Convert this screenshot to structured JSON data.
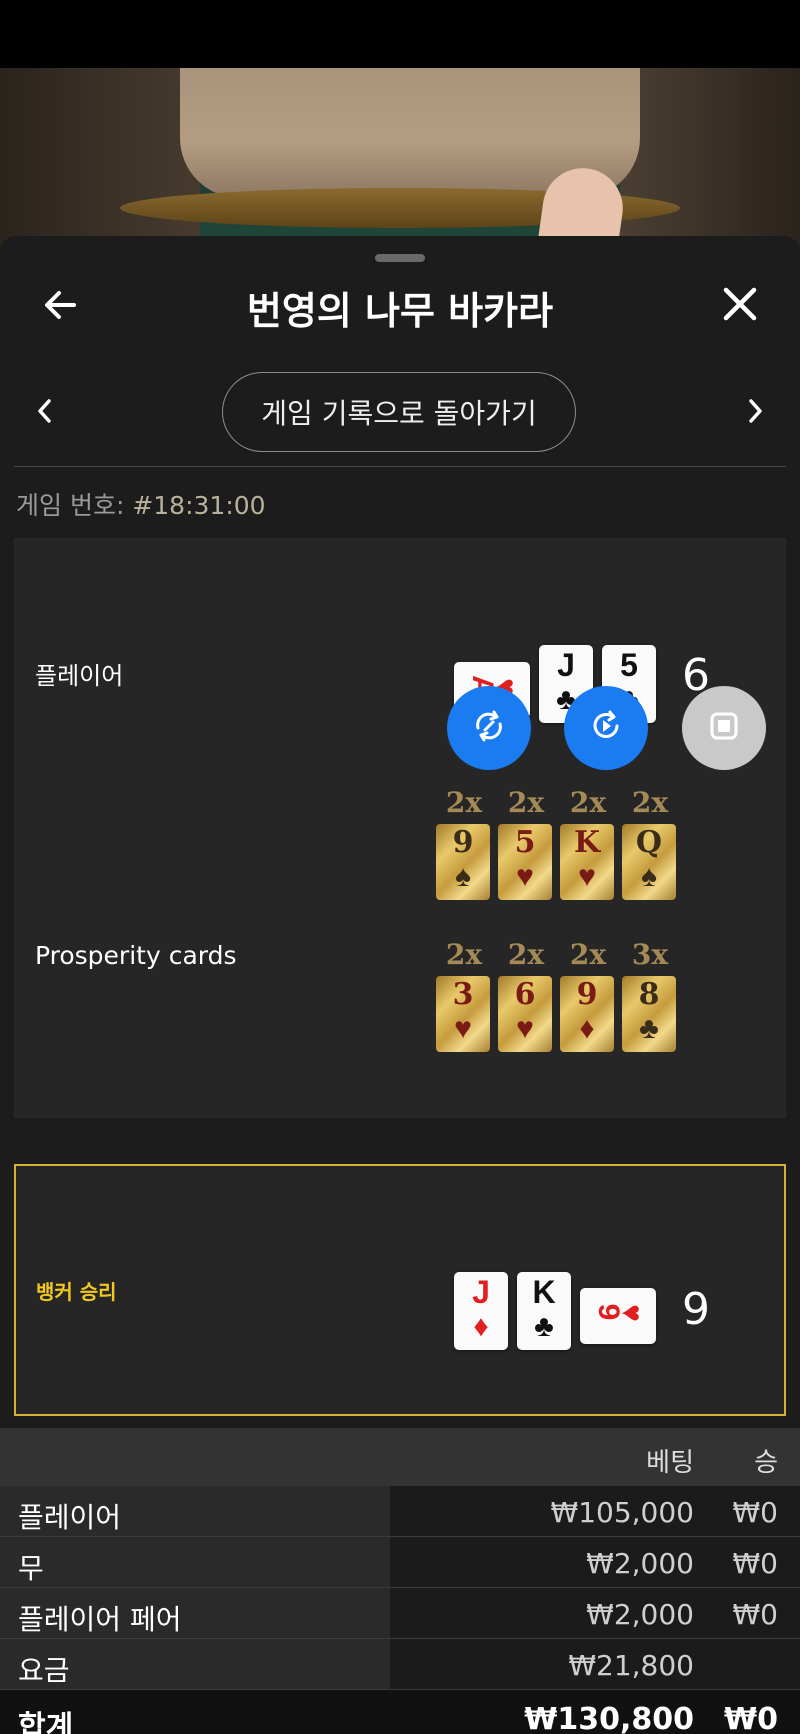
{
  "header": {
    "title": "번영의 나무 바카라"
  },
  "nav": {
    "back_to_history": "게임 기록으로 돌아가기"
  },
  "game": {
    "number_label": "게임 번호:",
    "number_value": "#18:31:00"
  },
  "player": {
    "label": "플레이어",
    "score": "6",
    "cards": [
      {
        "rank": "A",
        "suit": "♥",
        "color": "red"
      },
      {
        "rank": "J",
        "suit": "♣",
        "color": "black"
      },
      {
        "rank": "5",
        "suit": "♣",
        "color": "black"
      }
    ]
  },
  "prosperity": {
    "label": "Prosperity cards",
    "row1": [
      {
        "mult": "2x",
        "rank": "9",
        "suit": "♠",
        "color": "dark"
      },
      {
        "mult": "2x",
        "rank": "5",
        "suit": "♥",
        "color": "red"
      },
      {
        "mult": "2x",
        "rank": "K",
        "suit": "♥",
        "color": "red"
      },
      {
        "mult": "2x",
        "rank": "Q",
        "suit": "♠",
        "color": "dark"
      }
    ],
    "row2": [
      {
        "mult": "2x",
        "rank": "3",
        "suit": "♥",
        "color": "red"
      },
      {
        "mult": "2x",
        "rank": "6",
        "suit": "♥",
        "color": "red"
      },
      {
        "mult": "2x",
        "rank": "9",
        "suit": "♦",
        "color": "red"
      },
      {
        "mult": "3x",
        "rank": "8",
        "suit": "♣",
        "color": "dark"
      }
    ]
  },
  "banker": {
    "label": "뱅커 승리",
    "score": "9",
    "cards": [
      {
        "rank": "J",
        "suit": "♦",
        "color": "red"
      },
      {
        "rank": "K",
        "suit": "♣",
        "color": "black"
      },
      {
        "rank": "9",
        "suit": "♥",
        "color": "red"
      }
    ]
  },
  "bets_table": {
    "headers": {
      "bet": "베팅",
      "win": "승"
    },
    "rows": [
      {
        "label": "플레이어",
        "bet": "₩105,000",
        "win": "₩0"
      },
      {
        "label": "무",
        "bet": "₩2,000",
        "win": "₩0"
      },
      {
        "label": "플레이어 페어",
        "bet": "₩2,000",
        "win": "₩0"
      },
      {
        "label": "요금",
        "bet": "₩21,800",
        "win": ""
      }
    ],
    "total": {
      "label": "합계",
      "bet": "₩130,800",
      "win": "₩0"
    }
  },
  "icons": {
    "back": "arrow-left-icon",
    "close": "close-icon",
    "prev": "chevron-left-icon",
    "next": "chevron-right-icon",
    "replay": "replay-icon",
    "play": "play-icon",
    "stop": "stop-icon"
  },
  "colors": {
    "accent_blue": "#1b7cf2",
    "winner_gold": "#f0c81e",
    "panel": "#1c1c1c"
  }
}
